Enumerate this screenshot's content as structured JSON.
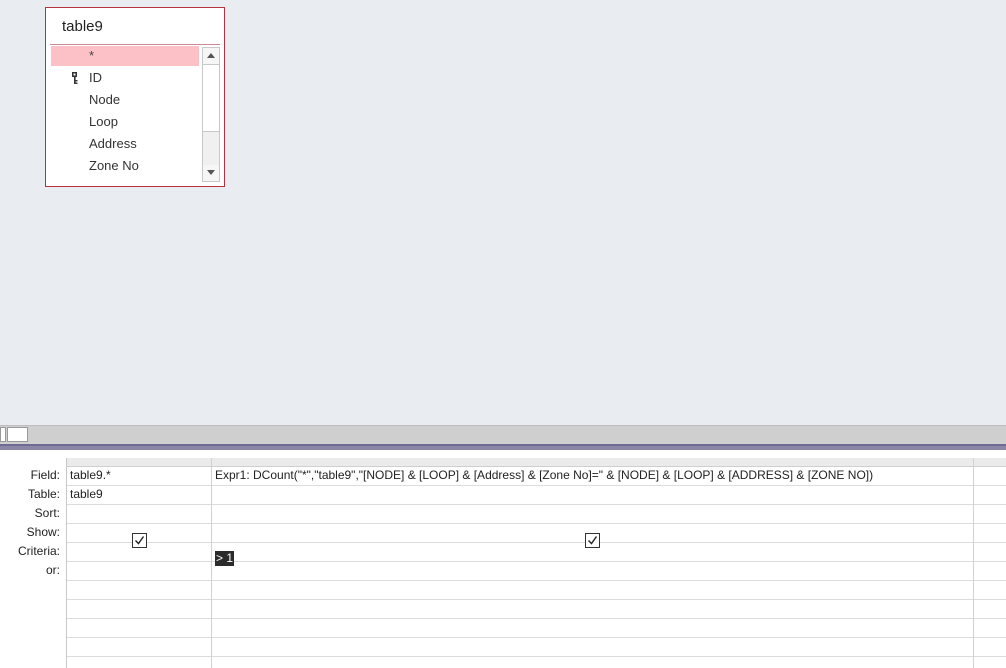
{
  "table_window": {
    "title": "table9",
    "fields": [
      {
        "label": "*",
        "selected": true,
        "key": false
      },
      {
        "label": "ID",
        "selected": false,
        "key": true
      },
      {
        "label": "Node",
        "selected": false,
        "key": false
      },
      {
        "label": "Loop",
        "selected": false,
        "key": false
      },
      {
        "label": "Address",
        "selected": false,
        "key": false
      },
      {
        "label": "Zone No",
        "selected": false,
        "key": false
      }
    ],
    "key_icon": "primary-key-icon"
  },
  "grid": {
    "row_labels": {
      "field": "Field:",
      "table": "Table:",
      "sort": "Sort:",
      "show": "Show:",
      "criteria": "Criteria:",
      "or": "or:"
    },
    "columns": [
      {
        "field": "table9.*",
        "table": "table9",
        "sort": "",
        "show": true,
        "criteria": "",
        "or": ""
      },
      {
        "field": "Expr1: DCount(\"*\",\"table9\",\"[NODE] &  [LOOP] & [Address]  &  [Zone No]=\" & [NODE] & [LOOP] & [ADDRESS] & [ZONE NO])",
        "table": "",
        "sort": "",
        "show": true,
        "criteria": "> 1",
        "or": ""
      }
    ]
  },
  "colors": {
    "window_border": "#b8313f",
    "selected_field": "#fcc1c6",
    "splitter": "#8a87a6",
    "background": "#e9edf1"
  }
}
